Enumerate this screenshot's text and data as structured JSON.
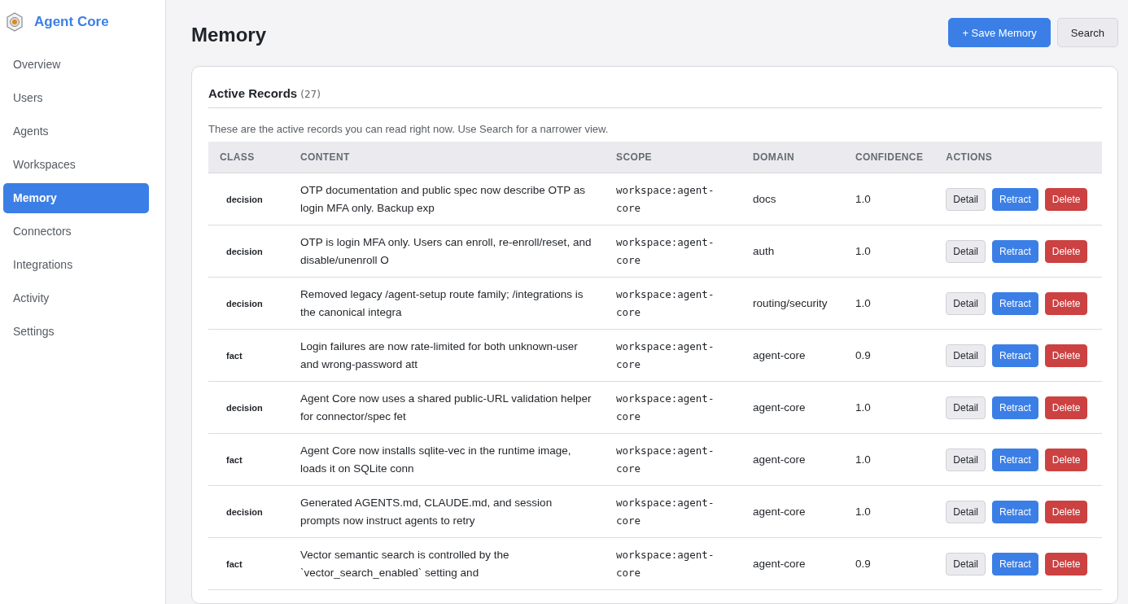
{
  "app": {
    "name": "Agent Core"
  },
  "nav": [
    {
      "label": "Overview",
      "selected": false
    },
    {
      "label": "Users",
      "selected": false
    },
    {
      "label": "Agents",
      "selected": false
    },
    {
      "label": "Workspaces",
      "selected": false
    },
    {
      "label": "Memory",
      "selected": true
    },
    {
      "label": "Connectors",
      "selected": false
    },
    {
      "label": "Integrations",
      "selected": false
    },
    {
      "label": "Activity",
      "selected": false
    },
    {
      "label": "Settings",
      "selected": false
    }
  ],
  "page": {
    "title": "Memory",
    "buttons": [
      {
        "label": "+ Save Memory",
        "kind": "primary"
      },
      {
        "label": "Search",
        "kind": "secondary"
      }
    ]
  },
  "card": {
    "title": "Active Records",
    "count": "(27)",
    "description": "These are the active records you can read right now. Use Search for a narrower view."
  },
  "table": {
    "columns": [
      "CLASS",
      "CONTENT",
      "SCOPE",
      "DOMAIN",
      "CONFIDENCE",
      "ACTIONS"
    ],
    "rows": [
      {
        "class": "decision",
        "content": "OTP documentation and public spec now describe OTP as login MFA only. Backup exp",
        "scope": "workspace:agent-core",
        "domain": "docs",
        "confidence": "1.0",
        "actions": [
          "Detail",
          "Retract",
          "Delete"
        ]
      },
      {
        "class": "decision",
        "content": "OTP is login MFA only. Users can enroll, re-enroll/reset, and disable/unenroll O",
        "scope": "workspace:agent-core",
        "domain": "auth",
        "confidence": "1.0",
        "actions": [
          "Detail",
          "Retract",
          "Delete"
        ]
      },
      {
        "class": "decision",
        "content": "Removed legacy /agent-setup route family; /integrations is the canonical integra",
        "scope": "workspace:agent-core",
        "domain": "routing/security",
        "confidence": "1.0",
        "actions": [
          "Detail",
          "Retract",
          "Delete"
        ]
      },
      {
        "class": "fact",
        "content": "Login failures are now rate-limited for both unknown-user and wrong-password att",
        "scope": "workspace:agent-core",
        "domain": "agent-core",
        "confidence": "0.9",
        "actions": [
          "Detail",
          "Retract",
          "Delete"
        ]
      },
      {
        "class": "decision",
        "content": "Agent Core now uses a shared public-URL validation helper for connector/spec fet",
        "scope": "workspace:agent-core",
        "domain": "agent-core",
        "confidence": "1.0",
        "actions": [
          "Detail",
          "Retract",
          "Delete"
        ]
      },
      {
        "class": "fact",
        "content": "Agent Core now installs sqlite-vec in the runtime image, loads it on SQLite conn",
        "scope": "workspace:agent-core",
        "domain": "agent-core",
        "confidence": "1.0",
        "actions": [
          "Detail",
          "Retract",
          "Delete"
        ]
      },
      {
        "class": "decision",
        "content": "Generated AGENTS.md, CLAUDE.md, and session prompts now instruct agents to retry",
        "scope": "workspace:agent-core",
        "domain": "agent-core",
        "confidence": "1.0",
        "actions": [
          "Detail",
          "Retract",
          "Delete"
        ]
      },
      {
        "class": "fact",
        "content": "Vector semantic search is controlled by the `vector_search_enabled` setting and",
        "scope": "workspace:agent-core",
        "domain": "agent-core",
        "confidence": "0.9",
        "actions": [
          "Detail",
          "Retract",
          "Delete"
        ]
      }
    ]
  }
}
